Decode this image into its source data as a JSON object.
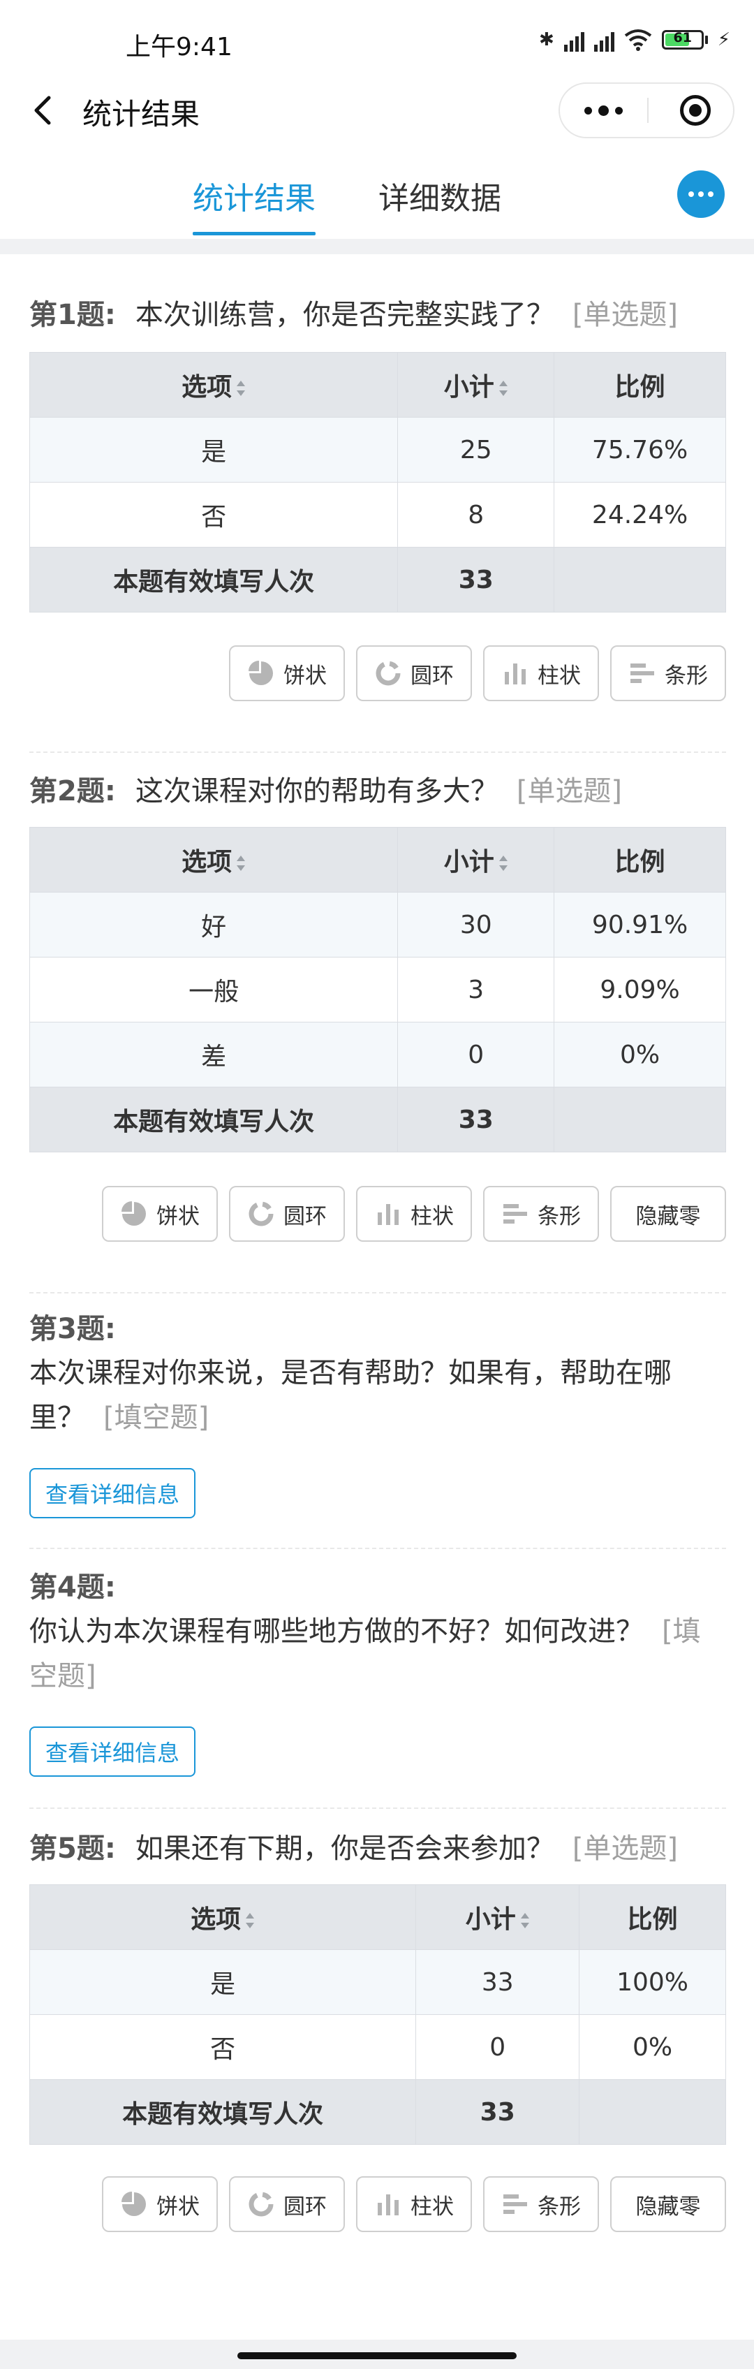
{
  "status_bar": {
    "time": "上午9:41",
    "battery": "61"
  },
  "nav": {
    "title": "统计结果"
  },
  "tabs": [
    {
      "label": "统计结果",
      "active": true
    },
    {
      "label": "详细数据",
      "active": false
    }
  ],
  "table_header": {
    "option": "选项",
    "count": "小计",
    "ratio": "比例"
  },
  "total_label": "本题有效填写人次",
  "chart_buttons": {
    "pie": "饼状",
    "ring": "圆环",
    "bar": "柱状",
    "strip": "条形",
    "hide_zero": "隐藏零"
  },
  "detail_button": "查看详细信息",
  "questions": [
    {
      "number": "第1题:",
      "text": "本次训练营，你是否完整实践了？",
      "type": "[单选题]",
      "rows": [
        {
          "option": "是",
          "count": "25",
          "ratio": "75.76%"
        },
        {
          "option": "否",
          "count": "8",
          "ratio": "24.24%"
        }
      ],
      "total": "33"
    },
    {
      "number": "第2题:",
      "text": "这次课程对你的帮助有多大？",
      "type": "[单选题]",
      "rows": [
        {
          "option": "好",
          "count": "30",
          "ratio": "90.91%"
        },
        {
          "option": "一般",
          "count": "3",
          "ratio": "9.09%"
        },
        {
          "option": "差",
          "count": "0",
          "ratio": "0%"
        }
      ],
      "total": "33"
    },
    {
      "number": "第3题:",
      "text": "本次课程对你来说，是否有帮助？如果有，帮助在哪里？",
      "type": "[填空题]"
    },
    {
      "number": "第4题:",
      "text": "你认为本次课程有哪些地方做的不好？如何改进？",
      "type": "[填空题]"
    },
    {
      "number": "第5题:",
      "text": "如果还有下期，你是否会来参加？",
      "type": "[单选题]",
      "rows": [
        {
          "option": "是",
          "count": "33",
          "ratio": "100%"
        },
        {
          "option": "否",
          "count": "0",
          "ratio": "0%"
        }
      ],
      "total": "33"
    }
  ]
}
